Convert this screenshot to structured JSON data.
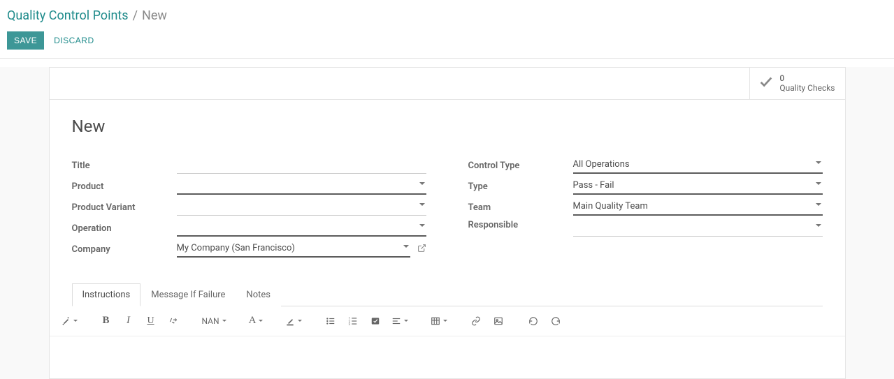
{
  "breadcrumb": {
    "root": "Quality Control Points",
    "sep": "/",
    "current": "New"
  },
  "buttons": {
    "save": "SAVE",
    "discard": "DISCARD"
  },
  "stat": {
    "count": "0",
    "label": "Quality Checks"
  },
  "form": {
    "title_heading": "New",
    "left": {
      "title_label": "Title",
      "title_value": "",
      "product_label": "Product",
      "product_value": "",
      "variant_label": "Product Variant",
      "variant_value": "",
      "operation_label": "Operation",
      "operation_value": "",
      "company_label": "Company",
      "company_value": "My Company (San Francisco)"
    },
    "right": {
      "control_type_label": "Control Type",
      "control_type_value": "All Operations",
      "type_label": "Type",
      "type_value": "Pass - Fail",
      "team_label": "Team",
      "team_value": "Main Quality Team",
      "responsible_label": "Responsible",
      "responsible_value": ""
    }
  },
  "tabs": {
    "instructions": "Instructions",
    "message_if_failure": "Message If Failure",
    "notes": "Notes"
  },
  "toolbar": {
    "font_size_label": "NAN",
    "font_family_label": "A"
  }
}
